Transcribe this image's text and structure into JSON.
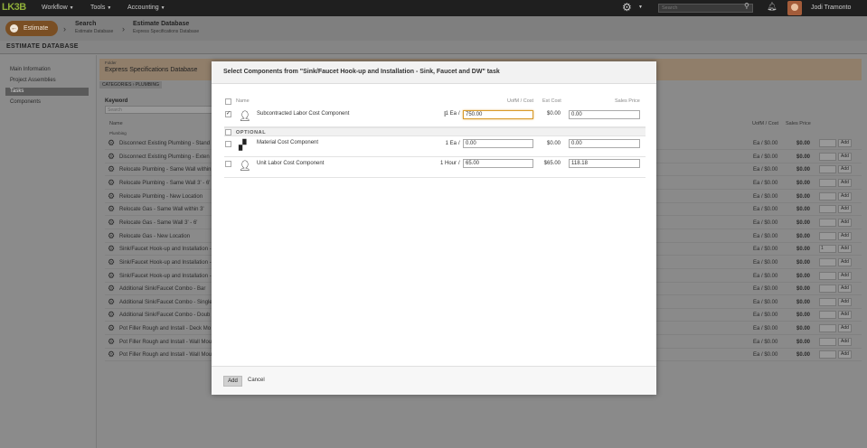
{
  "topbar": {
    "logo": "LK3B",
    "menus": [
      {
        "label": "Workflow"
      },
      {
        "label": "Tools"
      },
      {
        "label": "Accounting"
      }
    ],
    "search_placeholder": "Search",
    "user_name": "Jodi Tramonto",
    "icons": {
      "gear": "gear-icon",
      "search": "search-icon",
      "bell": "bell-icon"
    }
  },
  "breadcrumbs": {
    "back_button": "Estimate",
    "items": [
      {
        "title": "Search",
        "sub": "Estimate Database"
      },
      {
        "title": "Estimate Database",
        "sub": "Express Specifications Database"
      }
    ]
  },
  "page_title": "ESTIMATE DATABASE",
  "sidebar": {
    "items": [
      {
        "label": "Main Information"
      },
      {
        "label": "Project Assemblies"
      },
      {
        "label": "Tasks"
      },
      {
        "label": "Components"
      }
    ]
  },
  "background": {
    "header_sub": "Folder",
    "header_title": "Express Specifications Database",
    "tabs": [
      "CATEGORIES",
      "PLUMBING"
    ],
    "keyword_label": "Keyword",
    "keyword_placeholder": "Search",
    "col_name": "Name",
    "col_sub": "Plumbing",
    "col_uom": "UofM / Cost",
    "col_price": "Sales Price",
    "add_label": "Add",
    "rows": [
      {
        "name": "Disconnect Existing Plumbing - Stand",
        "uom": "Ea / $0.00",
        "price": "$0.00",
        "qty": ""
      },
      {
        "name": "Disconnect Existing Plumbing - Exten",
        "uom": "Ea / $0.00",
        "price": "$0.00",
        "qty": ""
      },
      {
        "name": "Relocate Plumbing - Same Wall within",
        "uom": "Ea / $0.00",
        "price": "$0.00",
        "qty": ""
      },
      {
        "name": "Relocate Plumbing - Same Wall 3' - 6'",
        "uom": "Ea / $0.00",
        "price": "$0.00",
        "qty": ""
      },
      {
        "name": "Relocate Plumbing - New Location",
        "uom": "Ea / $0.00",
        "price": "$0.00",
        "qty": ""
      },
      {
        "name": "Relocate Gas - Same Wall within 3'",
        "uom": "Ea / $0.00",
        "price": "$0.00",
        "qty": ""
      },
      {
        "name": "Relocate Gas - Same Wall 3' - 6'",
        "uom": "Ea / $0.00",
        "price": "$0.00",
        "qty": ""
      },
      {
        "name": "Relocate Gas - New Location",
        "uom": "Ea / $0.00",
        "price": "$0.00",
        "qty": ""
      },
      {
        "name": "Sink/Faucet Hook-up and Installation -",
        "uom": "Ea / $0.00",
        "price": "$0.00",
        "qty": "1"
      },
      {
        "name": "Sink/Faucet Hook-up and Installation -",
        "uom": "Ea / $0.00",
        "price": "$0.00",
        "qty": ""
      },
      {
        "name": "Sink/Faucet Hook-up and Installation -",
        "uom": "Ea / $0.00",
        "price": "$0.00",
        "qty": ""
      },
      {
        "name": "Additional Sink/Faucet Combo - Bar",
        "uom": "Ea / $0.00",
        "price": "$0.00",
        "qty": ""
      },
      {
        "name": "Additional Sink/Faucet Combo - Single",
        "uom": "Ea / $0.00",
        "price": "$0.00",
        "qty": ""
      },
      {
        "name": "Additional Sink/Faucet Combo - Doub",
        "uom": "Ea / $0.00",
        "price": "$0.00",
        "qty": ""
      },
      {
        "name": "Pot Filler Rough and Install - Deck Mo",
        "uom": "Ea / $0.00",
        "price": "$0.00",
        "qty": ""
      },
      {
        "name": "Pot Filler Rough and Install - Wall Mou",
        "uom": "Ea / $0.00",
        "price": "$0.00",
        "qty": ""
      },
      {
        "name": "Pot Filler Rough and Install - Wall Mou",
        "uom": "Ea / $0.00",
        "price": "$0.00",
        "qty": ""
      }
    ]
  },
  "dialog": {
    "title": "Select Components from \"Sink/Faucet Hook-up and Installation - Sink, Faucet and DW\" task",
    "col_name": "Name",
    "col_uom": "UofM / Cost",
    "col_est": "Est Cost",
    "col_price": "Sales Price",
    "optional_label": "OPTIONAL",
    "components": [
      {
        "name": "Subcontracted Labor Cost Component",
        "checked": "✓",
        "qty": "1 Ea",
        "cost": "750.00",
        "est": "$0.00",
        "price": "0.00",
        "icon": "person-icon"
      },
      {
        "name": "Material Cost Component",
        "checked": "",
        "qty": "1 Ea",
        "cost": "0.00",
        "est": "$0.00",
        "price": "0.00",
        "icon": "bricks-icon"
      },
      {
        "name": "Unit Labor Cost Component",
        "checked": "",
        "qty": "1 Hour",
        "cost": "65.00",
        "est": "$65.00",
        "price": "118.18",
        "icon": "person-icon"
      }
    ],
    "add_label": "Add",
    "cancel_label": "Cancel"
  }
}
